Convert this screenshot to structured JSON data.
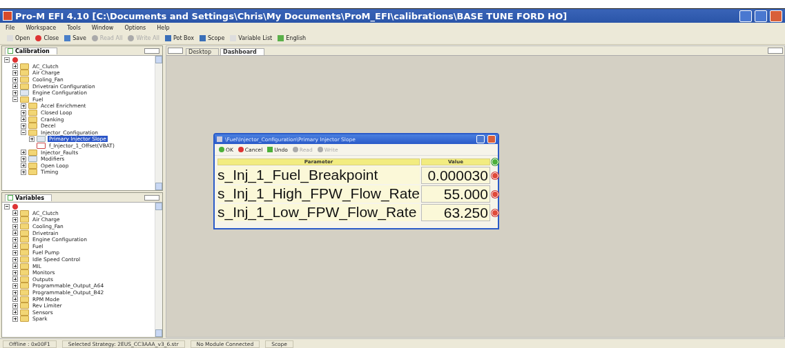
{
  "window": {
    "title": "Pro-M EFI 4.10 [C:\\Documents and Settings\\Chris\\My Documents\\ProM_EFI\\calibrations\\BASE TUNE FORD HO]"
  },
  "menu": [
    "File",
    "Workspace",
    "Tools",
    "Window",
    "Options",
    "Help"
  ],
  "toolbar": [
    {
      "label": "Open",
      "kind": "open",
      "disabled": false
    },
    {
      "label": "Close",
      "kind": "close",
      "disabled": false
    },
    {
      "label": "Save",
      "kind": "save",
      "disabled": false
    },
    {
      "label": "Read All",
      "kind": "read",
      "disabled": true
    },
    {
      "label": "Write All",
      "kind": "write",
      "disabled": true
    },
    {
      "label": "Pot Box",
      "kind": "monitor",
      "disabled": false
    },
    {
      "label": "Scope",
      "kind": "monitor",
      "disabled": false
    },
    {
      "label": "Variable List",
      "kind": "list",
      "disabled": false
    },
    {
      "label": "English",
      "kind": "units",
      "disabled": false
    }
  ],
  "panels": [
    {
      "title": "Calibration",
      "tree": [
        {
          "kind": "root",
          "expanded": true,
          "children": [
            {
              "label": "AC_Clutch",
              "kind": "folder",
              "expanded": false,
              "selected": false
            },
            {
              "label": "Air Charge",
              "kind": "folder",
              "expanded": false,
              "selected": false
            },
            {
              "label": "Cooling_Fan",
              "kind": "folder",
              "expanded": false,
              "selected": false
            },
            {
              "label": "Drivetrain Configuration",
              "kind": "folder",
              "expanded": false,
              "selected": false
            },
            {
              "label": "Engine Configuration",
              "kind": "table",
              "expanded": false,
              "selected": false
            },
            {
              "label": "Fuel",
              "kind": "folder",
              "expanded": true,
              "selected": false,
              "children": [
                {
                  "label": "Accel Enrichment",
                  "kind": "folder",
                  "expanded": false,
                  "selected": false
                },
                {
                  "label": "Closed Loop",
                  "kind": "folder",
                  "expanded": false,
                  "selected": false
                },
                {
                  "label": "Cranking",
                  "kind": "folder",
                  "expanded": false,
                  "selected": false
                },
                {
                  "label": "Decel",
                  "kind": "folder",
                  "expanded": false,
                  "selected": false
                },
                {
                  "label": "Injector_Configuration",
                  "kind": "folder",
                  "expanded": true,
                  "selected": false,
                  "children": [
                    {
                      "label": "Primary Injector Slope",
                      "kind": "table",
                      "expanded": false,
                      "selected": true
                    },
                    {
                      "label": "f_Injector_1_Offset(VBAT)",
                      "kind": "graph",
                      "selected": false
                    }
                  ]
                },
                {
                  "label": "Injector_Faults",
                  "kind": "folder",
                  "expanded": false,
                  "selected": false
                },
                {
                  "label": "Modifiers",
                  "kind": "table",
                  "expanded": false,
                  "selected": false
                },
                {
                  "label": "Open Loop",
                  "kind": "folder",
                  "expanded": false,
                  "selected": false
                },
                {
                  "label": "Timing",
                  "kind": "folder",
                  "expanded": false,
                  "selected": false
                }
              ]
            }
          ]
        }
      ]
    },
    {
      "title": "Variables",
      "tree": [
        {
          "kind": "root",
          "expanded": true,
          "children": [
            {
              "label": "AC_Clutch",
              "kind": "folder",
              "expanded": false,
              "selected": false
            },
            {
              "label": "Air Charge",
              "kind": "folder",
              "expanded": false,
              "selected": false
            },
            {
              "label": "Cooling_Fan",
              "kind": "folder",
              "expanded": false,
              "selected": false
            },
            {
              "label": "Drivetrain",
              "kind": "folder",
              "expanded": false,
              "selected": false
            },
            {
              "label": "Engine Configuration",
              "kind": "folder",
              "expanded": false,
              "selected": false
            },
            {
              "label": "Fuel",
              "kind": "folder",
              "expanded": false,
              "selected": false
            },
            {
              "label": "Fuel Pump",
              "kind": "folder",
              "expanded": false,
              "selected": false
            },
            {
              "label": "Idle Speed Control",
              "kind": "folder",
              "expanded": false,
              "selected": false
            },
            {
              "label": "MIL",
              "kind": "folder",
              "expanded": false,
              "selected": false
            },
            {
              "label": "Monitors",
              "kind": "folder",
              "expanded": false,
              "selected": false
            },
            {
              "label": "Outputs",
              "kind": "folder",
              "expanded": false,
              "selected": false
            },
            {
              "label": "Programmable_Output_A64",
              "kind": "folder",
              "expanded": false,
              "selected": false
            },
            {
              "label": "Programmable_Output_B42",
              "kind": "folder",
              "expanded": false,
              "selected": false
            },
            {
              "label": "RPM Mode",
              "kind": "folder",
              "expanded": false,
              "selected": false
            },
            {
              "label": "Rev Limiter",
              "kind": "folder",
              "expanded": false,
              "selected": false
            },
            {
              "label": "Sensors",
              "kind": "folder",
              "expanded": false,
              "selected": false
            },
            {
              "label": "Spark",
              "kind": "folder",
              "expanded": false,
              "selected": false
            }
          ]
        }
      ]
    }
  ],
  "workspace_tabs": [
    {
      "label": "Desktop",
      "selected": false
    },
    {
      "label": "Dashboard",
      "selected": true
    }
  ],
  "dialog": {
    "title": "\\Fuel\\Injector_Configuration\\Primary Injector Slope",
    "actions": [
      {
        "label": "OK",
        "kind": "ok",
        "disabled": false
      },
      {
        "label": "Cancel",
        "kind": "cancel",
        "disabled": false
      },
      {
        "label": "Undo",
        "kind": "undo",
        "disabled": false
      },
      {
        "label": "Read",
        "kind": "read",
        "disabled": true
      },
      {
        "label": "Write",
        "kind": "write",
        "disabled": true
      }
    ],
    "columns": [
      "Parameter",
      "Value"
    ],
    "rows": [
      {
        "parameter": "s_Inj_1_Fuel_Breakpoint",
        "value": "0.000030"
      },
      {
        "parameter": "s_Inj_1_High_FPW_Flow_Rate",
        "value": "55.000"
      },
      {
        "parameter": "s_Inj_1_Low_FPW_Flow_Rate",
        "value": "63.250"
      }
    ]
  },
  "status_bar": [
    "Offline : 0x00F1",
    "Selected Strategy: 2EUS_CC3AAA_v3_6.str",
    "No Module Connected",
    "Scope"
  ]
}
